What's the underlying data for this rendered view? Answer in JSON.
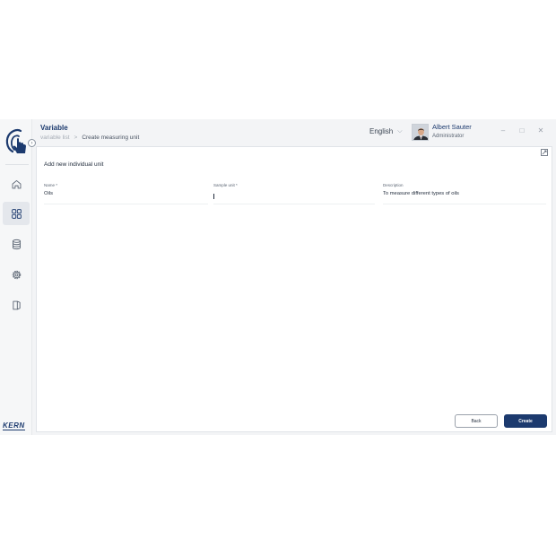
{
  "header": {
    "title": "Variable",
    "breadcrumb": {
      "link": "variable list",
      "separator": ">",
      "current": "Create measuring unit"
    },
    "language": "English",
    "user": {
      "name": "Albert Sauter",
      "role": "Administrator"
    }
  },
  "sidebar": {
    "brand": "KERN",
    "items": [
      {
        "icon": "home-icon",
        "active": false
      },
      {
        "icon": "dashboard-grid-icon",
        "active": true
      },
      {
        "icon": "database-icon",
        "active": false
      },
      {
        "icon": "settings-gear-icon",
        "active": false
      },
      {
        "icon": "logout-icon",
        "active": false
      }
    ]
  },
  "form": {
    "title": "Add new individual unit",
    "fields": {
      "name": {
        "label": "Name *",
        "value": "Oils"
      },
      "sample_unit": {
        "label": "Sample unit *",
        "value": ""
      },
      "description": {
        "label": "Description",
        "value": "To measure different types of oils"
      }
    },
    "buttons": {
      "back": "Back",
      "create": "Create"
    }
  },
  "colors": {
    "brand_navy": "#1c3a6e",
    "background": "#f3f4f6",
    "surface": "#ffffff"
  }
}
